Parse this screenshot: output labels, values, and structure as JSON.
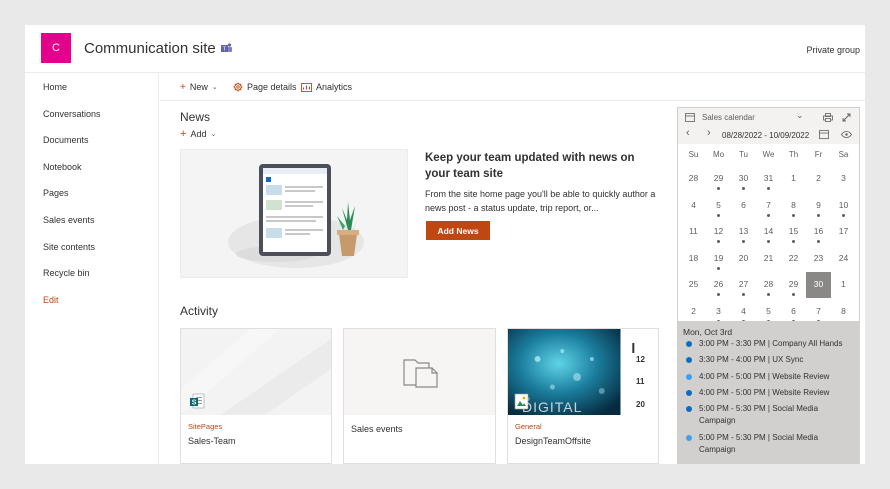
{
  "site": {
    "logo_letter": "C",
    "title": "Communication site",
    "privacy": "Private group"
  },
  "nav": {
    "items": [
      "Home",
      "Conversations",
      "Documents",
      "Notebook",
      "Pages",
      "Sales events",
      "Site contents",
      "Recycle bin"
    ],
    "edit": "Edit"
  },
  "commands": {
    "new": "New",
    "page_details": "Page details",
    "analytics": "Analytics"
  },
  "news": {
    "title": "News",
    "add": "Add",
    "heading": "Keep your team updated with news on your team site",
    "body": "From the site home page you'll be able to quickly author a news post - a status update, trip report, or...",
    "button": "Add News"
  },
  "activity": {
    "title": "Activity",
    "cards": [
      {
        "category": "SitePages",
        "name": "Sales-Team"
      },
      {
        "category": "",
        "name": "Sales events"
      },
      {
        "category": "General",
        "name": "DesignTeamOffsite",
        "calendar_numbers": [
          "12",
          "11",
          "20"
        ],
        "overlay_text": "DIGITAL"
      }
    ]
  },
  "calendar": {
    "title": "Sales calendar",
    "range": "08/28/2022 - 10/09/2022",
    "weekdays": [
      "Su",
      "Mo",
      "Tu",
      "We",
      "Th",
      "Fr",
      "Sa"
    ],
    "weeks": [
      [
        {
          "d": "28",
          "dot": false
        },
        {
          "d": "29",
          "dot": true
        },
        {
          "d": "30",
          "dot": true
        },
        {
          "d": "31",
          "dot": true
        },
        {
          "d": "1",
          "dot": false
        },
        {
          "d": "2",
          "dot": false
        },
        {
          "d": "3",
          "dot": false
        }
      ],
      [
        {
          "d": "4",
          "dot": false
        },
        {
          "d": "5",
          "dot": true
        },
        {
          "d": "6",
          "dot": false
        },
        {
          "d": "7",
          "dot": true
        },
        {
          "d": "8",
          "dot": true
        },
        {
          "d": "9",
          "dot": true
        },
        {
          "d": "10",
          "dot": true
        }
      ],
      [
        {
          "d": "11",
          "dot": false
        },
        {
          "d": "12",
          "dot": true
        },
        {
          "d": "13",
          "dot": true
        },
        {
          "d": "14",
          "dot": true
        },
        {
          "d": "15",
          "dot": true
        },
        {
          "d": "16",
          "dot": true
        },
        {
          "d": "17",
          "dot": false
        }
      ],
      [
        {
          "d": "18",
          "dot": false
        },
        {
          "d": "19",
          "dot": true
        },
        {
          "d": "20",
          "dot": false
        },
        {
          "d": "21",
          "dot": false
        },
        {
          "d": "22",
          "dot": false
        },
        {
          "d": "23",
          "dot": false
        },
        {
          "d": "24",
          "dot": false
        }
      ],
      [
        {
          "d": "25",
          "dot": false
        },
        {
          "d": "26",
          "dot": true
        },
        {
          "d": "27",
          "dot": true
        },
        {
          "d": "28",
          "dot": true
        },
        {
          "d": "29",
          "dot": true
        },
        {
          "d": "30",
          "dot": false,
          "selected": true
        },
        {
          "d": "1",
          "dot": false
        }
      ],
      [
        {
          "d": "2",
          "dot": false
        },
        {
          "d": "3",
          "dot": true
        },
        {
          "d": "4",
          "dot": true
        },
        {
          "d": "5",
          "dot": true
        },
        {
          "d": "6",
          "dot": true
        },
        {
          "d": "7",
          "dot": true
        },
        {
          "d": "8",
          "dot": false
        }
      ]
    ],
    "agenda_date": "Mon, Oct 3rd",
    "events": [
      {
        "text": "3:00 PM - 3:30 PM | Company All Hands",
        "color": "#0f6cbd"
      },
      {
        "text": "3:30 PM - 4:00 PM | UX Sync",
        "color": "#0f6cbd"
      },
      {
        "text": "4:00 PM - 5:00 PM | Website Review",
        "color": "#3aa0f3"
      },
      {
        "text": "4:00 PM - 5:00 PM | Website Review",
        "color": "#0f6cbd"
      },
      {
        "text": "5:00 PM - 5:30 PM | Social Media Campaign",
        "color": "#0f6cbd"
      },
      {
        "text": "5:00 PM - 5:30 PM | Social Media Campaign",
        "color": "#3aa0f3"
      }
    ]
  },
  "colors": {
    "brand": "#e3008c",
    "accent": "#c14712",
    "event_dark": "#0f6cbd",
    "event_light": "#3aa0f3"
  }
}
